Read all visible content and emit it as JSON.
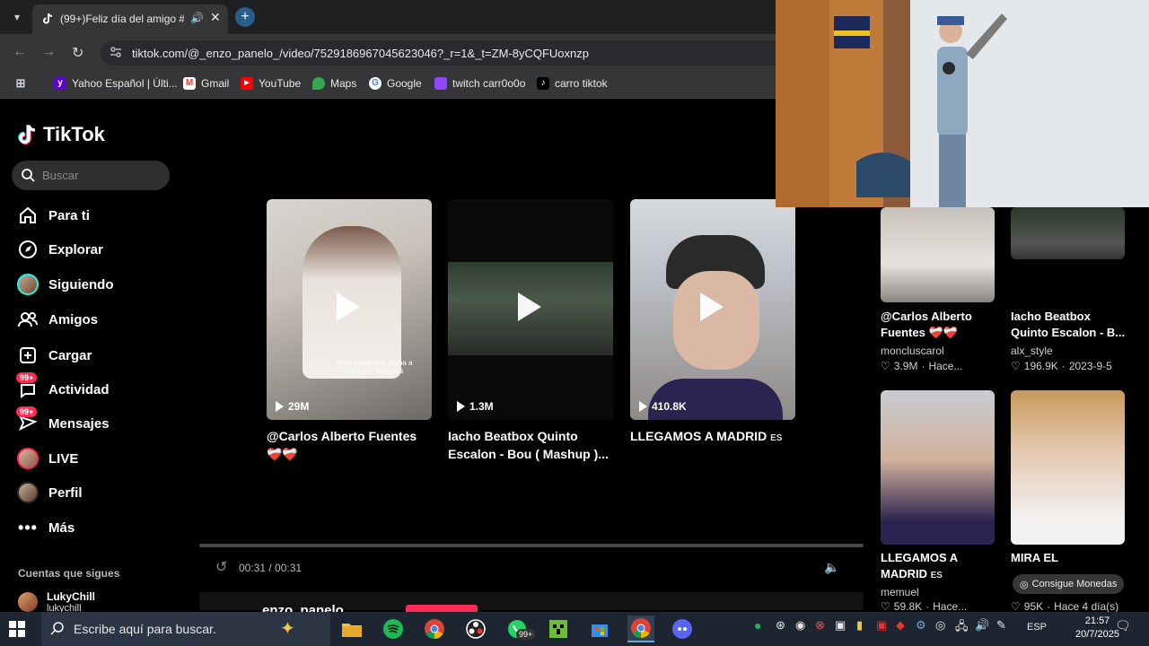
{
  "browser": {
    "tab_title": "(99+)Feliz día del amigo #m",
    "url": "tiktok.com/@_enzo_panelo_/video/7529186967045623046?_r=1&_t=ZM-8yCQFUoxnzp",
    "bookmarks": [
      {
        "label": "Yahoo Español | Últi...",
        "icon": "yahoo-icon",
        "color": "#6001d2"
      },
      {
        "label": "Gmail",
        "icon": "gmail-icon",
        "color": "#ea4335"
      },
      {
        "label": "YouTube",
        "icon": "youtube-icon",
        "color": "#ff0000"
      },
      {
        "label": "Maps",
        "icon": "maps-icon",
        "color": "#34a853"
      },
      {
        "label": "Google",
        "icon": "google-icon",
        "color": "#4285f4"
      },
      {
        "label": "twitch carr0o0o",
        "icon": "twitch-icon",
        "color": "#9146ff"
      },
      {
        "label": "carro tiktok",
        "icon": "tiktok-icon",
        "color": "#000000"
      }
    ]
  },
  "tiktok": {
    "logo_text": "TikTok",
    "search_placeholder": "Buscar",
    "nav": [
      {
        "label": "Para ti",
        "icon": "home-icon"
      },
      {
        "label": "Explorar",
        "icon": "compass-icon"
      },
      {
        "label": "Siguiendo",
        "icon": "following-avatar"
      },
      {
        "label": "Amigos",
        "icon": "friends-icon"
      },
      {
        "label": "Cargar",
        "icon": "upload-icon"
      },
      {
        "label": "Actividad",
        "icon": "activity-icon",
        "badge": "99+"
      },
      {
        "label": "Mensajes",
        "icon": "messages-icon",
        "badge": "99+"
      },
      {
        "label": "LIVE",
        "icon": "live-avatar"
      },
      {
        "label": "Perfil",
        "icon": "profile-avatar"
      },
      {
        "label": "Más",
        "icon": "more-icon"
      }
    ],
    "following_title": "Cuentas que sigues",
    "following": [
      {
        "name": "LukyChill",
        "handle": "lukychill"
      }
    ],
    "videos": [
      {
        "views": "29M",
        "caption": "@Carlos Alberto Fuentes ❤️‍🩹❤️‍🩹",
        "overlay": "él no sabía que yo iba a venir por sorpresa"
      },
      {
        "views": "1.3M",
        "caption": "Iacho Beatbox Quinto Escalon - Bou ( Mashup )..."
      },
      {
        "views": "410.8K",
        "caption": "LLEGAMOS A MADRID",
        "tag": "ES"
      }
    ],
    "player": {
      "time": "00:31 / 00:31",
      "author": "enzo_panelo"
    },
    "related": [
      {
        "title": "@Carlos Alberto Fuentes ❤️‍🩹❤️‍🩹",
        "user": "moncluscarol",
        "likes": "3.9M",
        "date": "Hace..."
      },
      {
        "title": "Iacho Beatbox Quinto Escalon - B...",
        "user": "alx_style",
        "likes": "196.9K",
        "date": "2023-9-5"
      },
      {
        "title": "LLEGAMOS A MADRID",
        "tag": "ES",
        "user": "memuel",
        "likes": "59.8K",
        "date": "Hace..."
      },
      {
        "title": "MIRA EL CONSEJITO DEL NUTRICIONIST...",
        "user": "m...",
        "likes": "95K",
        "date": "Hace 4 día(s)"
      }
    ],
    "coins_label": "Consigue Monedas"
  },
  "taskbar": {
    "search_text": "Escribe aquí para buscar.",
    "whatsapp_badge": "99+",
    "lang": "ESP",
    "time": "21:57",
    "date": "20/7/2025"
  }
}
